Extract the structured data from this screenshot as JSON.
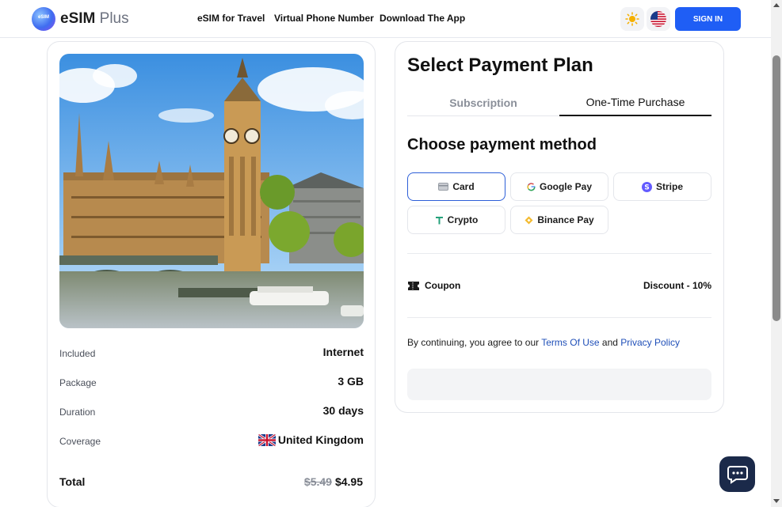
{
  "header": {
    "logo_badge": "eSIM",
    "logo_brand": "eSIM",
    "logo_suffix": "Plus",
    "nav": [
      "eSIM for Travel",
      "Virtual Phone Number",
      "Download The App"
    ],
    "theme_icon": "sun-icon",
    "language_icon": "us-flag-icon",
    "signin_label": "SIGN IN"
  },
  "product": {
    "image_icon": "london-big-ben-photo",
    "details": [
      {
        "label": "Included",
        "value": "Internet"
      },
      {
        "label": "Package",
        "value": "3 GB"
      },
      {
        "label": "Duration",
        "value": "30 days"
      },
      {
        "label": "Coverage",
        "value": "United Kingdom"
      }
    ],
    "coverage_flag_icon": "uk-flag-icon",
    "total_label": "Total",
    "old_price": "$5.49",
    "price": "$4.95"
  },
  "payment": {
    "title": "Select Payment Plan",
    "tabs": [
      {
        "label": "Subscription",
        "active": false
      },
      {
        "label": "One-Time Purchase",
        "active": true
      }
    ],
    "method_title": "Choose payment method",
    "methods": [
      {
        "label": "Card",
        "icon": "card-icon",
        "selected": true
      },
      {
        "label": "Google Pay",
        "icon": "google-icon",
        "selected": false
      },
      {
        "label": "Stripe",
        "icon": "stripe-icon",
        "selected": false
      },
      {
        "label": "Crypto",
        "icon": "tether-icon",
        "selected": false
      },
      {
        "label": "Binance Pay",
        "icon": "binance-icon",
        "selected": false
      }
    ],
    "coupon_label": "Coupon",
    "coupon_icon": "ticket-icon",
    "discount": "Discount - 10%",
    "terms_prefix": "By continuing, you agree to our",
    "terms_link": "Terms Of Use",
    "terms_and": "and",
    "privacy_link": "Privacy Policy"
  },
  "chat": {
    "icon": "chat-icon"
  },
  "colors": {
    "primary": "#1f5ef5",
    "link": "#1f4fb8",
    "selected_border": "#2d5fd8",
    "chat_bg": "#1b2a4a"
  }
}
